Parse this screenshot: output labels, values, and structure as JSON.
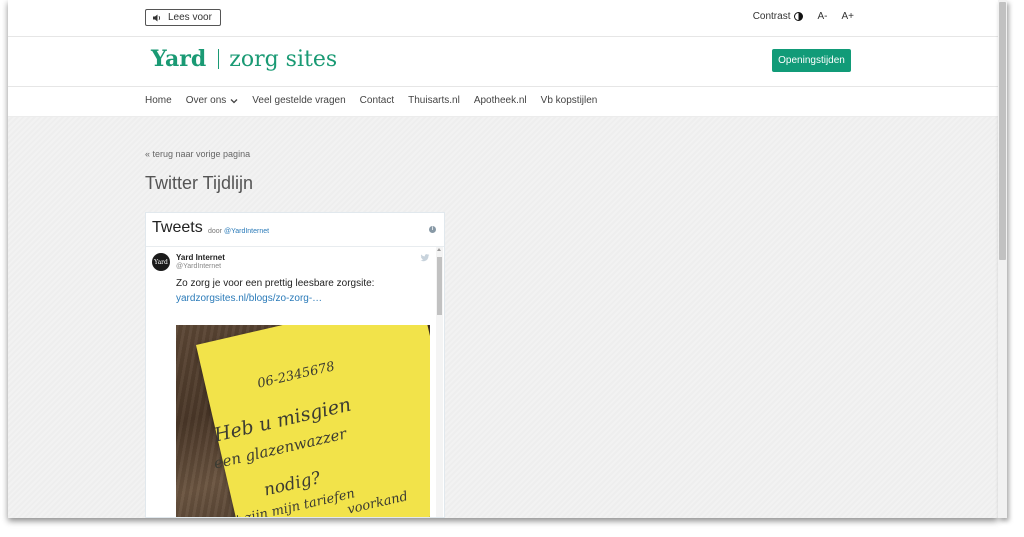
{
  "utility": {
    "read_label": "Lees voor",
    "contrast_label": "Contrast",
    "font_smaller": "A-",
    "font_larger": "A+"
  },
  "header": {
    "logo_yard": "Yard",
    "logo_rest": "zorg sites",
    "hours_button": "Openingstijden"
  },
  "nav": {
    "items": [
      "Home",
      "Over ons",
      "Veel gestelde vragen",
      "Contact",
      "Thuisarts.nl",
      "Apotheek.nl",
      "Vb kopstijlen"
    ]
  },
  "main": {
    "back_link": "« terug naar vorige pagina",
    "title": "Twitter Tijdlijn"
  },
  "twitter": {
    "heading": "Tweets",
    "by_prefix": "door",
    "by_handle": "@YardInternet",
    "tweet": {
      "avatar_text": "Yard",
      "name": "Yard Internet",
      "handle": "@YardInternet",
      "text": "Zo zorg je voor een prettig leesbare zorgsite:",
      "link": "yardzorgsites.nl/blogs/zo-zorg-…"
    },
    "photo_note_lines": [
      "06-2345678",
      "Heb u misgien",
      "een glazenwazzer",
      "nodig?",
      "Dit zijn mijn tariefen",
      "voorkand"
    ]
  },
  "colors": {
    "brand_green": "#1a9a74",
    "button_green": "#119b78",
    "link_blue": "#2b7bb9",
    "note_yellow": "#f2e34a"
  },
  "icons": [
    "speaker-icon",
    "contrast-icon",
    "chevron-down-icon",
    "info-icon",
    "twitter-bird-icon"
  ]
}
